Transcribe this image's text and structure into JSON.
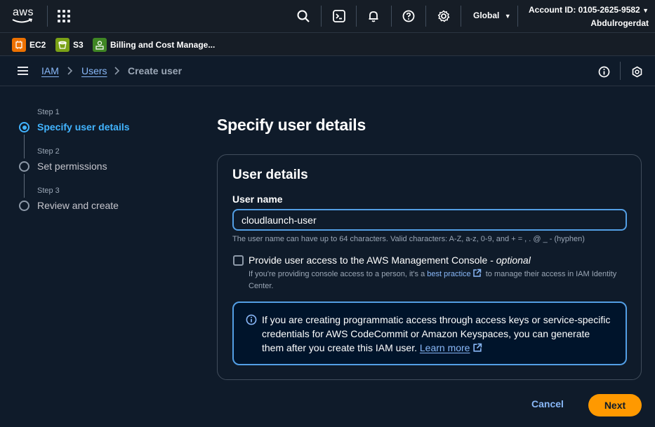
{
  "topnav": {
    "logo_text": "aws",
    "region": "Global",
    "account_id": "Account ID: 0105-2625-9582",
    "username": "Abdulrogerdat"
  },
  "favorites": [
    {
      "label": "EC2",
      "color": "#ed7100",
      "icon": "ec2-icon"
    },
    {
      "label": "S3",
      "color": "#7aa116",
      "icon": "s3-icon"
    },
    {
      "label": "Billing and Cost Manage...",
      "color": "#3f8624",
      "icon": "billing-icon"
    }
  ],
  "breadcrumb": {
    "items": [
      "IAM",
      "Users"
    ],
    "current": "Create user"
  },
  "steps": [
    {
      "label": "Step 1",
      "title": "Specify user details",
      "active": true
    },
    {
      "label": "Step 2",
      "title": "Set permissions",
      "active": false
    },
    {
      "label": "Step 3",
      "title": "Review and create",
      "active": false
    }
  ],
  "main": {
    "page_title": "Specify user details",
    "card_title": "User details",
    "username_label": "User name",
    "username_value": "cloudlaunch-user",
    "username_hint": "The user name can have up to 64 characters. Valid characters: A-Z, a-z, 0-9, and + = , . @ _ - (hyphen)",
    "console_access_label": "Provide user access to the AWS Management Console - ",
    "console_access_optional": "optional",
    "console_access_desc_1": "If you're providing console access to a person, it's a ",
    "console_access_desc_link": "best practice",
    "console_access_desc_2": " to manage their access in IAM Identity Center.",
    "console_access_checked": false,
    "info_text": "If you are creating programmatic access through access keys or service-specific credentials for AWS CodeCommit or Amazon Keyspaces, you can generate them after you create this IAM user. ",
    "info_link": "Learn more"
  },
  "footer": {
    "cancel_label": "Cancel",
    "next_label": "Next"
  },
  "colors": {
    "accent": "#42b4ff",
    "link": "#89b8f8",
    "primary_button": "#ff9900",
    "background": "#0f1b2a"
  }
}
